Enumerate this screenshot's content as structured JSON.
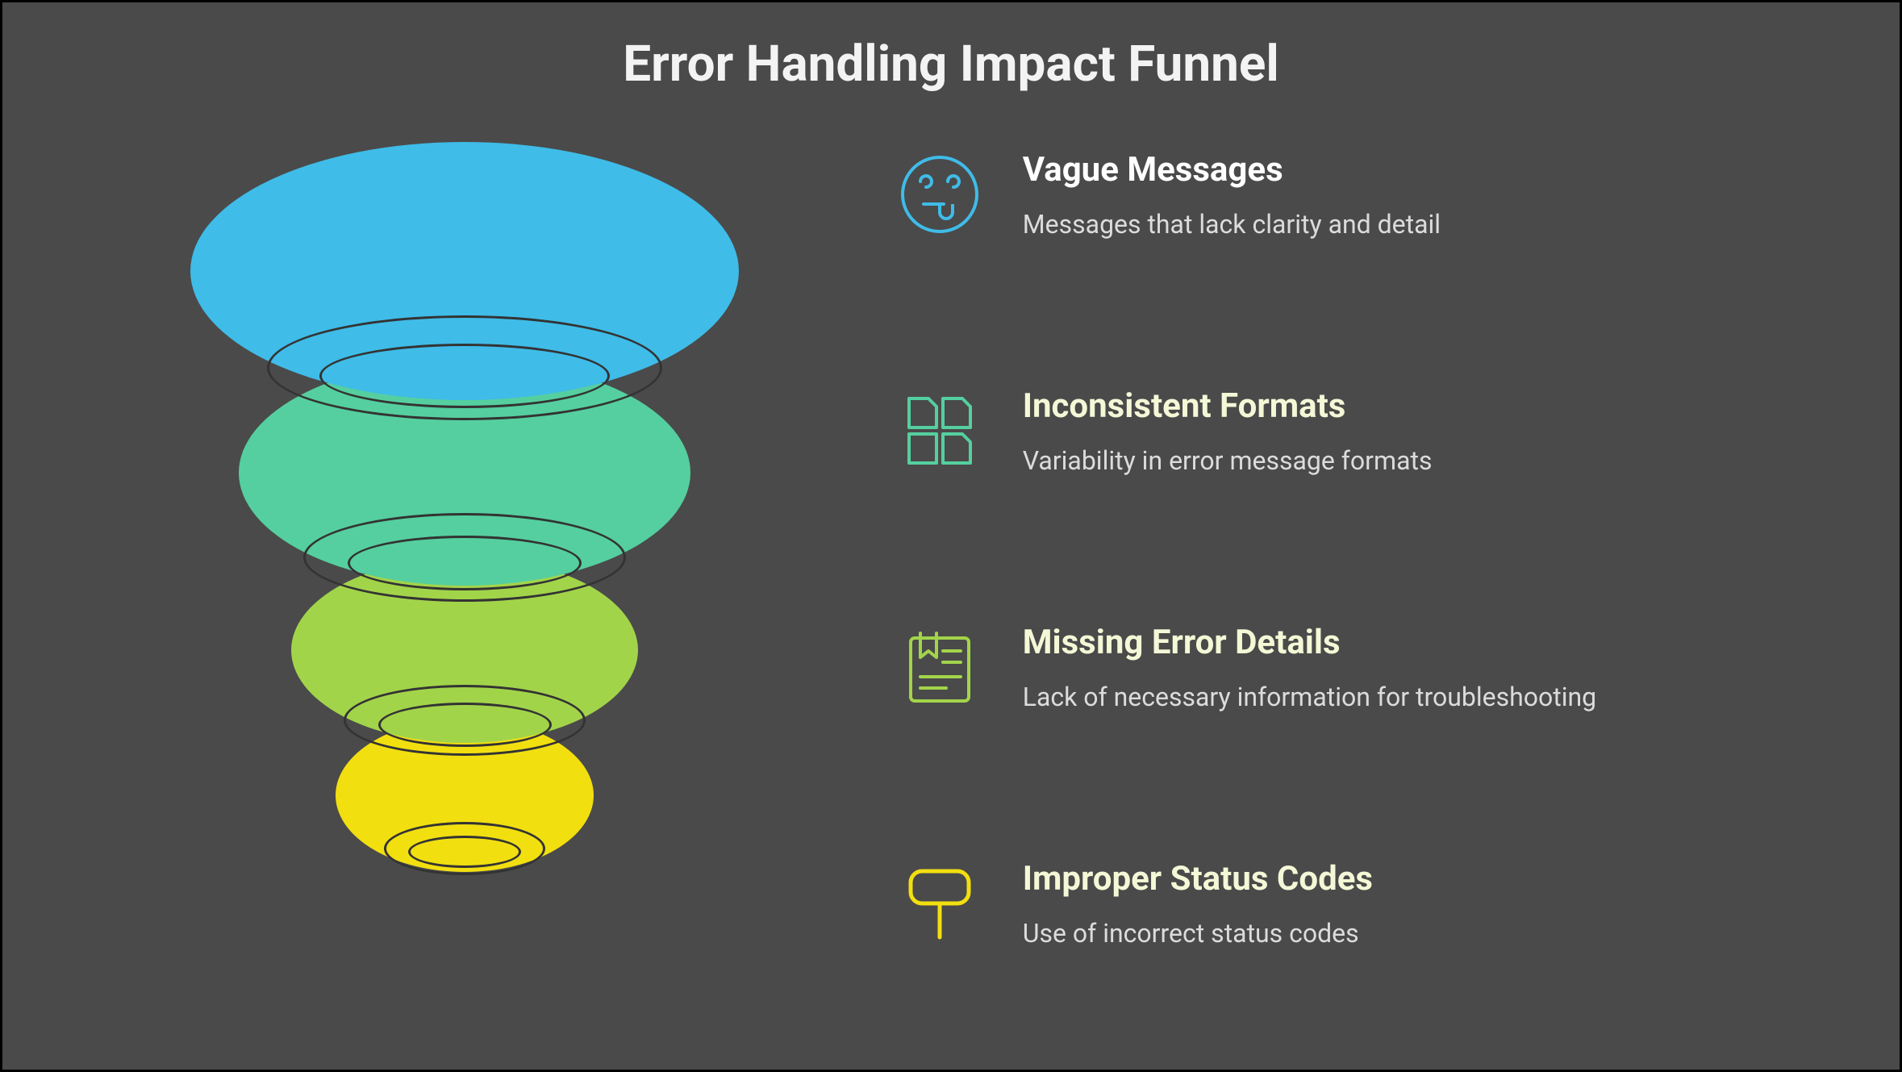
{
  "title": "Error Handling Impact Funnel",
  "items": [
    {
      "heading": "Vague Messages",
      "desc": "Messages that lack clarity and detail",
      "heading_color": "#ffffff",
      "desc_color": "#dcdcdc",
      "icon_color": "#3fbce8"
    },
    {
      "heading": "Inconsistent Formats",
      "desc": "Variability in error message formats",
      "heading_color": "#f4f8d6",
      "desc_color": "#dcdcdc",
      "icon_color": "#55cf9f"
    },
    {
      "heading": "Missing Error Details",
      "desc": "Lack of necessary information for troubleshooting",
      "heading_color": "#f4f8d6",
      "desc_color": "#dcdcdc",
      "icon_color": "#a2d44a"
    },
    {
      "heading": "Improper Status Codes",
      "desc": "Use of incorrect status codes",
      "heading_color": "#f4f8d6",
      "desc_color": "#dcdcdc",
      "icon_color": "#f2df10"
    }
  ],
  "funnel_colors": {
    "l1": "#3fbce8",
    "l2": "#55cf9f",
    "l3": "#a2d44a",
    "l4": "#f2df10"
  }
}
